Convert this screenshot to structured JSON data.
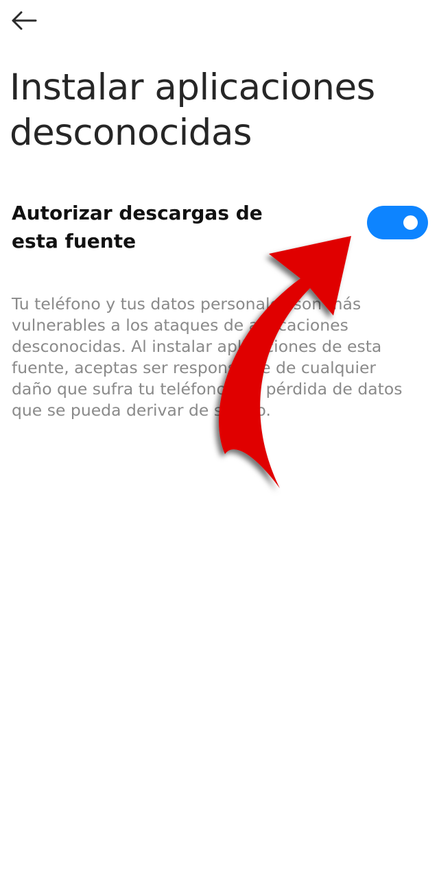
{
  "header": {
    "back_icon": "arrow-left-icon"
  },
  "page": {
    "title": "Instalar aplicaciones desconocidas"
  },
  "setting": {
    "label": "Autorizar descargas de esta fuente",
    "enabled": true,
    "accent_color": "#0d84ff"
  },
  "description": {
    "text": "Tu teléfono y tus datos personales son más vulnerables a los ataques de aplicaciones desconocidas. Al instalar aplicaciones de esta fuente, aceptas ser responsable de cualquier daño que sufra tu teléfono o la pérdida de datos que se pueda derivar de su uso."
  },
  "annotation": {
    "icon": "red-curved-arrow-icon",
    "color": "#e00000"
  }
}
